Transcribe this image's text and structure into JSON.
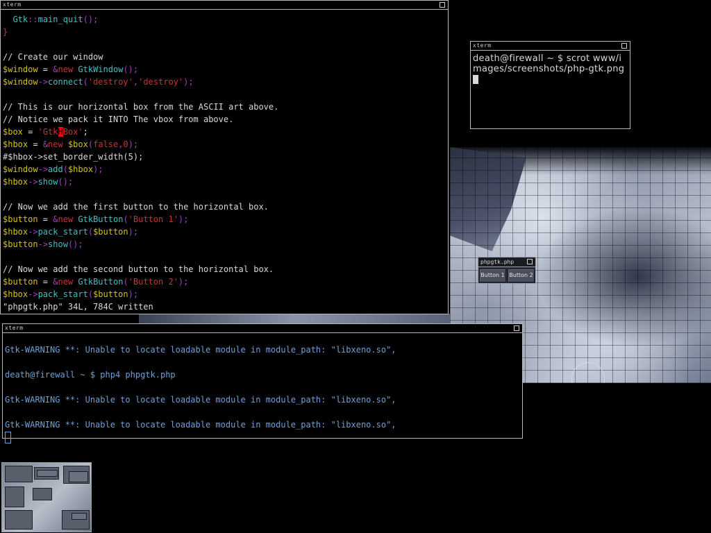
{
  "editor": {
    "title": "xterm",
    "lines": [
      [
        [
          "c-def",
          "  "
        ],
        [
          "c-fn",
          "Gtk"
        ],
        [
          "c-op",
          "::"
        ],
        [
          "c-fn",
          "main_quit"
        ],
        [
          "c-op",
          "();"
        ]
      ],
      [
        [
          "c-br",
          "}"
        ]
      ],
      [
        [
          "c-def",
          ""
        ]
      ],
      [
        [
          "c-cm",
          "// Create our window"
        ]
      ],
      [
        [
          "c-var",
          "$window"
        ],
        [
          "c-def",
          " = "
        ],
        [
          "c-op",
          "&"
        ],
        [
          "c-kw",
          "new "
        ],
        [
          "c-fn",
          "GtkWindow"
        ],
        [
          "c-op",
          "();"
        ]
      ],
      [
        [
          "c-var",
          "$window"
        ],
        [
          "c-op",
          "->"
        ],
        [
          "c-fn",
          "connect"
        ],
        [
          "c-op",
          "("
        ],
        [
          "c-str",
          "'destroy'"
        ],
        [
          "c-op",
          ","
        ],
        [
          "c-str",
          "'destroy'"
        ],
        [
          "c-op",
          ");"
        ]
      ],
      [
        [
          "c-def",
          ""
        ]
      ],
      [
        [
          "c-cm",
          "// This is our horizontal box from the ASCII art above."
        ]
      ],
      [
        [
          "c-cm",
          "// Notice we pack it INTO The vbox from above."
        ]
      ],
      [
        [
          "c-var",
          "$box"
        ],
        [
          "c-def",
          " = "
        ],
        [
          "c-str",
          "'Gtk"
        ],
        [
          "hl",
          "H"
        ],
        [
          "c-str",
          "Box'"
        ],
        [
          "c-def",
          ";"
        ]
      ],
      [
        [
          "c-var",
          "$hbox"
        ],
        [
          "c-def",
          " = "
        ],
        [
          "c-op",
          "&"
        ],
        [
          "c-kw",
          "new "
        ],
        [
          "c-var",
          "$box"
        ],
        [
          "c-op",
          "("
        ],
        [
          "c-kw",
          "false"
        ],
        [
          "c-op",
          ","
        ],
        [
          "c-kw",
          "0"
        ],
        [
          "c-op",
          ");"
        ]
      ],
      [
        [
          "c-cm",
          "#$hbox->set_border_width(5);"
        ]
      ],
      [
        [
          "c-var",
          "$window"
        ],
        [
          "c-op",
          "->"
        ],
        [
          "c-fn",
          "add"
        ],
        [
          "c-op",
          "("
        ],
        [
          "c-var",
          "$hbox"
        ],
        [
          "c-op",
          ");"
        ]
      ],
      [
        [
          "c-var",
          "$hbox"
        ],
        [
          "c-op",
          "->"
        ],
        [
          "c-fn",
          "show"
        ],
        [
          "c-op",
          "();"
        ]
      ],
      [
        [
          "c-def",
          ""
        ]
      ],
      [
        [
          "c-cm",
          "// Now we add the first button to the horizontal box."
        ]
      ],
      [
        [
          "c-var",
          "$button"
        ],
        [
          "c-def",
          " = "
        ],
        [
          "c-op",
          "&"
        ],
        [
          "c-kw",
          "new "
        ],
        [
          "c-fn",
          "GtkButton"
        ],
        [
          "c-op",
          "("
        ],
        [
          "c-str",
          "'Button 1'"
        ],
        [
          "c-op",
          ");"
        ]
      ],
      [
        [
          "c-var",
          "$hbox"
        ],
        [
          "c-op",
          "->"
        ],
        [
          "c-fn",
          "pack_start"
        ],
        [
          "c-op",
          "("
        ],
        [
          "c-var",
          "$button"
        ],
        [
          "c-op",
          ");"
        ]
      ],
      [
        [
          "c-var",
          "$button"
        ],
        [
          "c-op",
          "->"
        ],
        [
          "c-fn",
          "show"
        ],
        [
          "c-op",
          "();"
        ]
      ],
      [
        [
          "c-def",
          ""
        ]
      ],
      [
        [
          "c-cm",
          "// Now we add the second button to the horizontal box."
        ]
      ],
      [
        [
          "c-var",
          "$button"
        ],
        [
          "c-def",
          " = "
        ],
        [
          "c-op",
          "&"
        ],
        [
          "c-kw",
          "new "
        ],
        [
          "c-fn",
          "GtkButton"
        ],
        [
          "c-op",
          "("
        ],
        [
          "c-str",
          "'Button 2'"
        ],
        [
          "c-op",
          ");"
        ]
      ],
      [
        [
          "c-var",
          "$hbox"
        ],
        [
          "c-op",
          "->"
        ],
        [
          "c-fn",
          "pack_start"
        ],
        [
          "c-op",
          "("
        ],
        [
          "c-var",
          "$button"
        ],
        [
          "c-op",
          ");"
        ]
      ],
      [
        [
          "c-cm",
          "\"phpgtk.php\" 34L, 784C written"
        ]
      ]
    ]
  },
  "scrot_term": {
    "title": "xterm",
    "text": "death@firewall ~ $ scrot www/images/screenshots/php-gtk.png"
  },
  "console": {
    "title": "xterm",
    "lines": [
      "Gtk-WARNING **: Unable to locate loadable module in module_path: \"libxeno.so\",",
      "",
      "death@firewall ~ $ php4 phpgtk.php",
      "",
      "Gtk-WARNING **: Unable to locate loadable module in module_path: \"libxeno.so\",",
      "",
      "Gtk-WARNING **: Unable to locate loadable module in module_path: \"libxeno.so\","
    ]
  },
  "phpgtk_window": {
    "title": "phpgtk.php",
    "button1": "Button 1",
    "button2": "Button 2"
  },
  "colors": {
    "console_text": "#6f9fd8",
    "variable": "#d4c400",
    "keyword": "#d03030",
    "function": "#40c0c0",
    "operator": "#a040c0"
  }
}
